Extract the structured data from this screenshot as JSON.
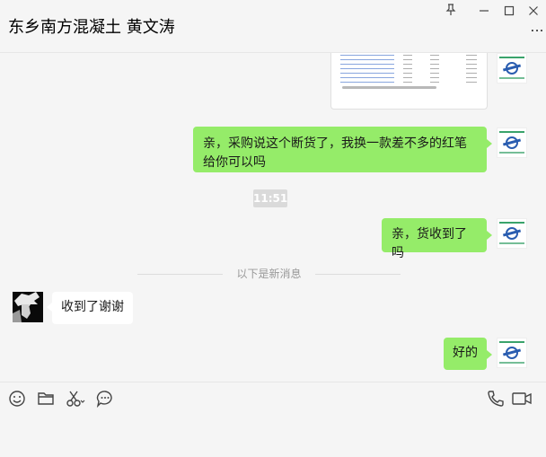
{
  "window": {
    "title": "东乡南方混凝土 黄文涛",
    "more_label": "..."
  },
  "messages": [
    {
      "type": "image",
      "sender": "me"
    },
    {
      "type": "text",
      "sender": "me",
      "text": "亲，采购说这个断货了，我换一款差不多的红笔给你可以吗"
    },
    {
      "type": "time",
      "text": "11:51"
    },
    {
      "type": "text",
      "sender": "me",
      "text": "亲，货收到了吗"
    },
    {
      "type": "divider",
      "text": "以下是新消息"
    },
    {
      "type": "text",
      "sender": "them",
      "text": "收到了谢谢"
    },
    {
      "type": "text",
      "sender": "me",
      "text": "好的"
    }
  ],
  "toolbar": {
    "left_icons": [
      "emoji-icon",
      "folder-icon",
      "scissors-icon",
      "chat-bubble-icon"
    ],
    "right_icons": [
      "phone-icon",
      "video-icon"
    ]
  },
  "colors": {
    "my_bubble": "#95ec69",
    "their_bubble": "#ffffff",
    "background": "#f5f5f5"
  }
}
